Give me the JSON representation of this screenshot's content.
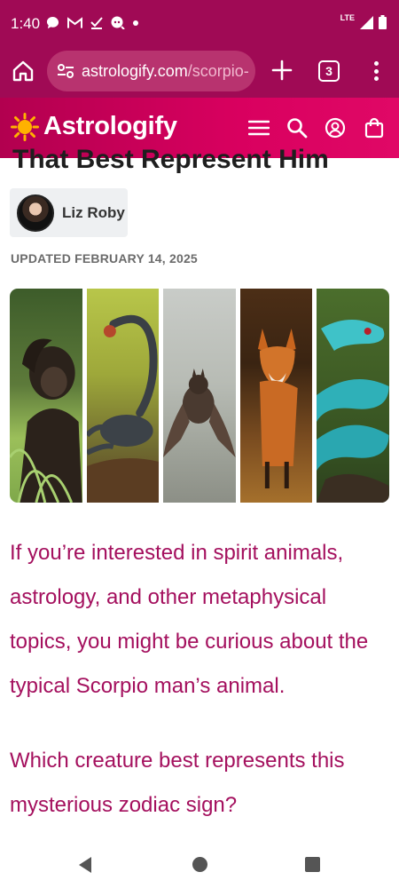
{
  "status_bar": {
    "time": "1:40",
    "network": "LTE"
  },
  "browser": {
    "url_domain": "astrologify.com",
    "url_path": "/scorpio-",
    "tab_count": "3"
  },
  "site": {
    "brand": "Astrologify"
  },
  "article": {
    "title_partial": "That Best Represent Him",
    "author": "Liz Roby",
    "updated": "UPDATED FEBRUARY 14, 2025",
    "hero_panels": [
      "chimpanzee",
      "scorpion",
      "bat",
      "fox",
      "snake"
    ],
    "paragraphs": [
      "If you’re interested in spirit animals, astrology, and other metaphysical topics, you might be curious about the typical Scorpio man’s animal.",
      "Which creature best represents this mysterious zodiac sign?"
    ]
  },
  "colors": {
    "browser_bar": "#a00a55",
    "header_start": "#b2004f",
    "header_end": "#e00866",
    "body_text": "#a4105e"
  }
}
